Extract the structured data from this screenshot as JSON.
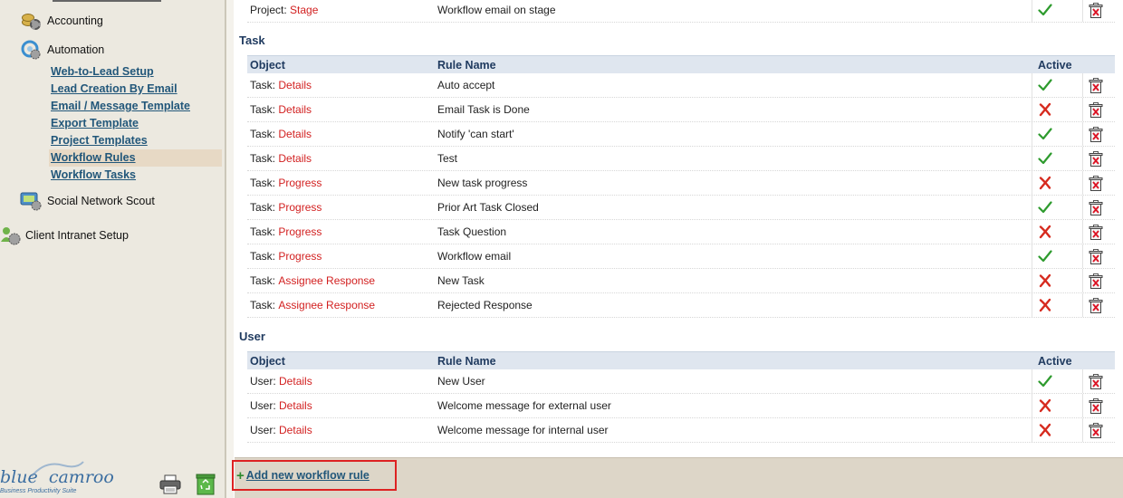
{
  "sidebar": {
    "sections": [
      {
        "label": "Accounting",
        "icon": "accounting-icon"
      },
      {
        "label": "Automation",
        "icon": "automation-icon"
      },
      {
        "label": "Social Network Scout",
        "icon": "social-network-scout-icon"
      },
      {
        "label": "Client Intranet Setup",
        "icon": "client-intranet-icon"
      }
    ],
    "automation_items": [
      {
        "label": "Web-to-Lead Setup",
        "active": false
      },
      {
        "label": "Lead Creation By Email",
        "active": false
      },
      {
        "label": "Email / Message Template",
        "active": false
      },
      {
        "label": "Export Template",
        "active": false
      },
      {
        "label": "Project Templates",
        "active": false
      },
      {
        "label": "Workflow Rules",
        "active": true
      },
      {
        "label": "Workflow Tasks",
        "active": false
      }
    ],
    "logo": {
      "word1": "blue",
      "word2": "camroo",
      "tagline": "Business Productivity Suite"
    },
    "colors": {
      "link": "#22577a",
      "active_bg": "#e7d9c5",
      "sidebar_bg": "#ece9e0"
    }
  },
  "table_headers": {
    "object": "Object",
    "rule_name": "Rule Name",
    "active": "Active"
  },
  "groups": {
    "project_row": {
      "prefix": "Project:",
      "link": "Stage",
      "rule": "Workflow email on stage",
      "active": true
    },
    "task": {
      "title": "Task",
      "rows": [
        {
          "prefix": "Task:",
          "link": "Details",
          "rule": "Auto accept",
          "active": true
        },
        {
          "prefix": "Task:",
          "link": "Details",
          "rule": "Email Task is Done",
          "active": false
        },
        {
          "prefix": "Task:",
          "link": "Details",
          "rule": "Notify 'can start'",
          "active": true
        },
        {
          "prefix": "Task:",
          "link": "Details",
          "rule": "Test",
          "active": true
        },
        {
          "prefix": "Task:",
          "link": "Progress",
          "rule": "New task progress",
          "active": false
        },
        {
          "prefix": "Task:",
          "link": "Progress",
          "rule": "Prior Art Task Closed",
          "active": true
        },
        {
          "prefix": "Task:",
          "link": "Progress",
          "rule": "Task Question",
          "active": false
        },
        {
          "prefix": "Task:",
          "link": "Progress",
          "rule": "Workflow email",
          "active": true
        },
        {
          "prefix": "Task:",
          "link": "Assignee Response",
          "rule": "New Task",
          "active": false
        },
        {
          "prefix": "Task:",
          "link": "Assignee Response",
          "rule": "Rejected Response",
          "active": false
        }
      ]
    },
    "user": {
      "title": "User",
      "rows": [
        {
          "prefix": "User:",
          "link": "Details",
          "rule": "New User",
          "active": true
        },
        {
          "prefix": "User:",
          "link": "Details",
          "rule": "Welcome message for external user",
          "active": false
        },
        {
          "prefix": "User:",
          "link": "Details",
          "rule": "Welcome message for internal user",
          "active": false
        }
      ]
    }
  },
  "footer": {
    "add_symbol": "+",
    "add_label": "Add new workflow rule"
  },
  "icons": {
    "active_true": "green-check-icon",
    "active_false": "red-x-icon",
    "delete": "trash-delete-icon"
  },
  "colors": {
    "object_link": "#d21f1f",
    "check": "#2e9b2e",
    "cross": "#d62a1e",
    "header_bg": "#dfe6ef",
    "highlight_border": "#dd2222"
  }
}
